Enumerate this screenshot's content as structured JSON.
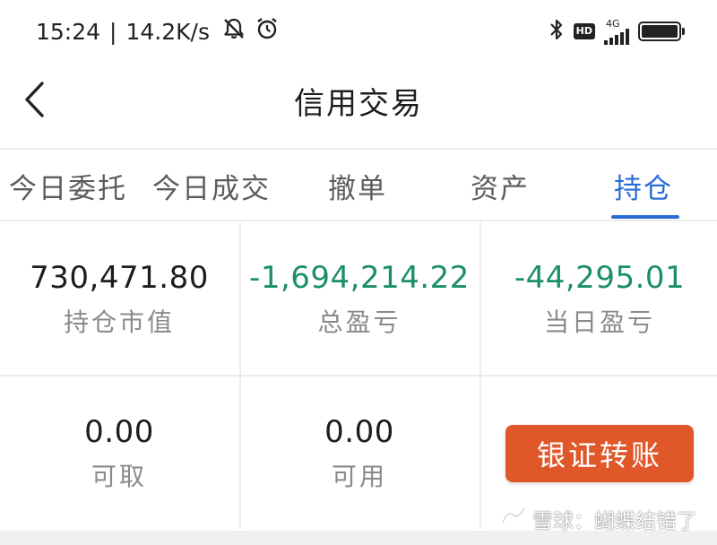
{
  "status_bar": {
    "time": "15:24",
    "separator": "|",
    "net_speed": "14.2K/s",
    "network_type": "4G",
    "hd_label": "HD",
    "icons": [
      "muted-bell-icon",
      "alarm-icon",
      "bluetooth-icon",
      "hd-icon",
      "signal-icon",
      "battery-icon"
    ]
  },
  "nav": {
    "title": "信用交易",
    "back_icon": "back-arrow-icon"
  },
  "tabs": [
    {
      "label": "今日委托",
      "active": false
    },
    {
      "label": "今日成交",
      "active": false
    },
    {
      "label": "撤单",
      "active": false
    },
    {
      "label": "资产",
      "active": false
    },
    {
      "label": "持仓",
      "active": true
    }
  ],
  "summary": {
    "market_value": {
      "value": "730,471.80",
      "label": "持仓市值"
    },
    "total_pnl": {
      "value": "-1,694,214.22",
      "label": "总盈亏"
    },
    "today_pnl": {
      "value": "-44,295.01",
      "label": "当日盈亏"
    },
    "withdrawable": {
      "value": "0.00",
      "label": "可取"
    },
    "available": {
      "value": "0.00",
      "label": "可用"
    },
    "transfer_button": "银证转账"
  },
  "watermark": {
    "text": "雪球：蝴蝶结错了"
  },
  "colors": {
    "accent": "#2a6cd6",
    "negative": "#1b8f6a",
    "button": "#e0582a"
  }
}
